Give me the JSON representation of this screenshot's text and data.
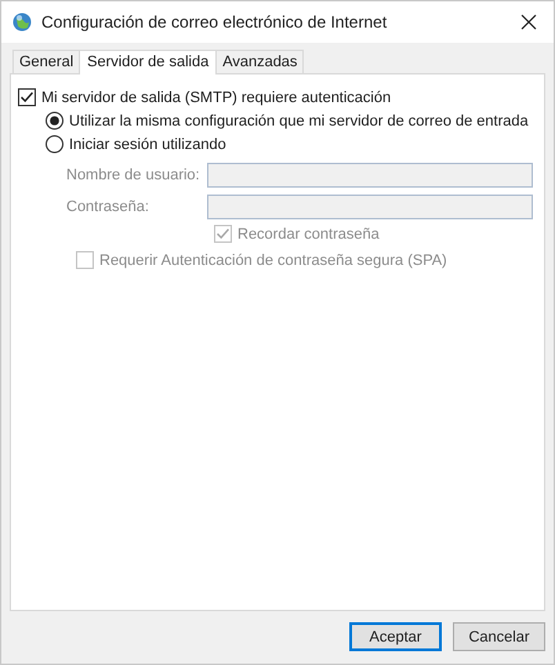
{
  "window": {
    "title": "Configuración de correo electrónico de Internet"
  },
  "tabs": [
    {
      "label": "General",
      "selected": false
    },
    {
      "label": "Servidor de salida",
      "selected": true
    },
    {
      "label": "Avanzadas",
      "selected": false
    }
  ],
  "auth": {
    "label": "Mi servidor de salida (SMTP) requiere autenticación",
    "checked": true
  },
  "options": [
    {
      "label": "Utilizar la misma configuración que mi servidor de correo de entrada",
      "selected": true
    },
    {
      "label": "Iniciar sesión utilizando",
      "selected": false
    }
  ],
  "fields": [
    {
      "label": "Nombre de usuario:",
      "disabled": true
    },
    {
      "label": "Contraseña:",
      "disabled": true
    }
  ],
  "remember": {
    "label": "Recordar contraseña",
    "checked": true,
    "disabled": true
  },
  "spa": {
    "label": "Requerir Autenticación de contraseña segura (SPA)",
    "checked": false,
    "disabled": true
  },
  "buttons": [
    {
      "label": "Aceptar",
      "default": true
    },
    {
      "label": "Cancelar",
      "default": false
    }
  ]
}
